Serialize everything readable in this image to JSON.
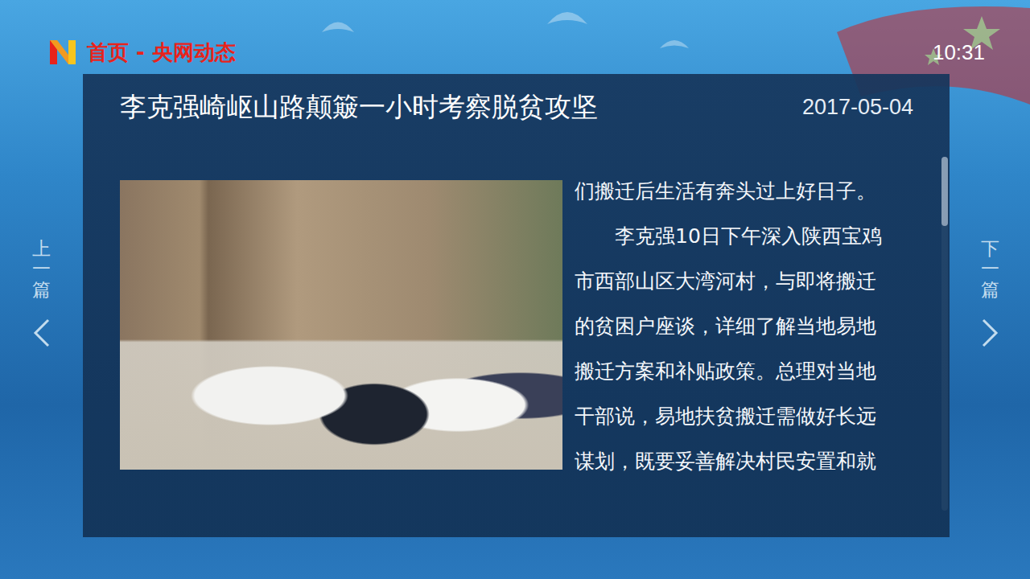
{
  "header": {
    "breadcrumb": "首页 - 央网动态",
    "time": "10:31"
  },
  "article": {
    "title": "李克强崎岖山路颠簸一小时考察脱贫攻坚",
    "date": "2017-05-04",
    "lines": [
      {
        "text": "们搬迁后生活有奔头过上好日子。",
        "indent": false
      },
      {
        "text": "李克强10日下午深入陕西宝鸡",
        "indent": true
      },
      {
        "text": "市西部山区大湾河村，与即将搬迁",
        "indent": false
      },
      {
        "text": "的贫困户座谈，详细了解当地易地",
        "indent": false
      },
      {
        "text": "搬迁方案和补贴政策。总理对当地",
        "indent": false
      },
      {
        "text": "干部说，易地扶贫搬迁需做好长远",
        "indent": false
      },
      {
        "text": "谋划，既要妥善解决村民安置和就",
        "indent": false
      }
    ]
  },
  "scrollbar": {
    "level": 0
  },
  "nav": {
    "prev": "上一篇",
    "next": "下一篇"
  }
}
